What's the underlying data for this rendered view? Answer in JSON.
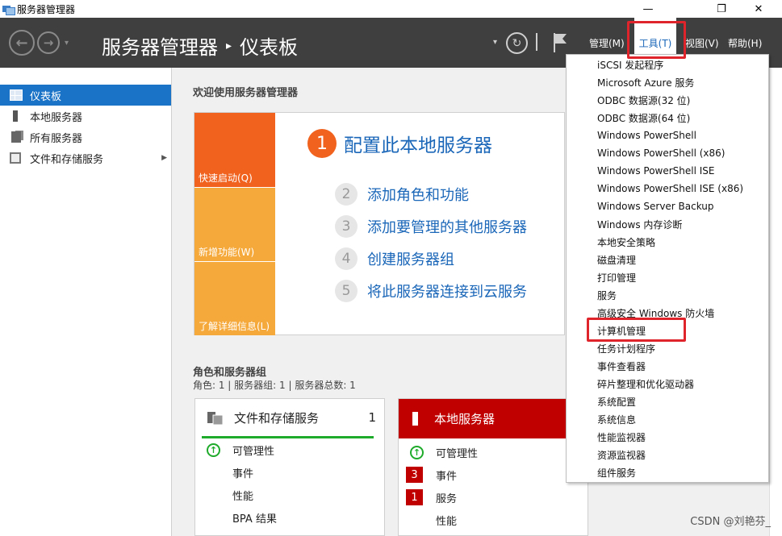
{
  "window": {
    "title": "服务器管理器",
    "minimize": "—",
    "restore": "❐",
    "close": "✕"
  },
  "header": {
    "back": "←",
    "forward": "→",
    "nav_dropdown": "▾",
    "breadcrumb_app": "服务器管理器",
    "breadcrumb_sep": "▸",
    "breadcrumb_page": "仪表板",
    "refresh": "↻",
    "refresh_dropdown": "▾",
    "menus": {
      "manage": "管理(M)",
      "tools": "工具(T)",
      "view": "视图(V)",
      "help": "帮助(H)"
    }
  },
  "sidebar": {
    "items": [
      {
        "label": "仪表板"
      },
      {
        "label": "本地服务器"
      },
      {
        "label": "所有服务器"
      },
      {
        "label": "文件和存储服务"
      }
    ],
    "expand_arrow": "▶"
  },
  "main": {
    "welcome_title": "欢迎使用服务器管理器",
    "quick_start": {
      "tiles": [
        "快速启动(Q)",
        "新增功能(W)",
        "了解详细信息(L)"
      ],
      "steps": [
        {
          "num": "1",
          "label": "配置此本地服务器"
        },
        {
          "num": "2",
          "label": "添加角色和功能"
        },
        {
          "num": "3",
          "label": "添加要管理的其他服务器"
        },
        {
          "num": "4",
          "label": "创建服务器组"
        },
        {
          "num": "5",
          "label": "将此服务器连接到云服务"
        }
      ]
    },
    "roles_title": "角色和服务器组",
    "roles_summary": "角色: 1 | 服务器组: 1 | 服务器总数: 1",
    "cards": [
      {
        "title": "文件和存储服务",
        "count": "1",
        "rows": [
          "可管理性",
          "事件",
          "性能",
          "BPA 结果"
        ]
      },
      {
        "title": "本地服务器",
        "rows": [
          "可管理性",
          "事件",
          "服务",
          "性能"
        ],
        "badges": [
          "3",
          "1"
        ]
      }
    ]
  },
  "tools_menu": {
    "items": [
      "iSCSI 发起程序",
      "Microsoft Azure 服务",
      "ODBC 数据源(32 位)",
      "ODBC 数据源(64 位)",
      "Windows PowerShell",
      "Windows PowerShell (x86)",
      "Windows PowerShell ISE",
      "Windows PowerShell ISE (x86)",
      "Windows Server Backup",
      "Windows 内存诊断",
      "本地安全策略",
      "磁盘清理",
      "打印管理",
      "服务",
      "高级安全 Windows 防火墙",
      "计算机管理",
      "任务计划程序",
      "事件查看器",
      "碎片整理和优化驱动器",
      "系统配置",
      "系统信息",
      "性能监视器",
      "资源监视器",
      "组件服务"
    ]
  },
  "watermark": "CSDN @刘艳芬_",
  "colors": {
    "header_bg": "#3f3f3f",
    "accent_blue": "#1a73c6",
    "quickstart_orange": "#f0621e",
    "tile_amber": "#f6a93b",
    "local_server_red": "#c00000",
    "ok_green": "#1eaa2a",
    "annotation_red": "#e0242c"
  }
}
